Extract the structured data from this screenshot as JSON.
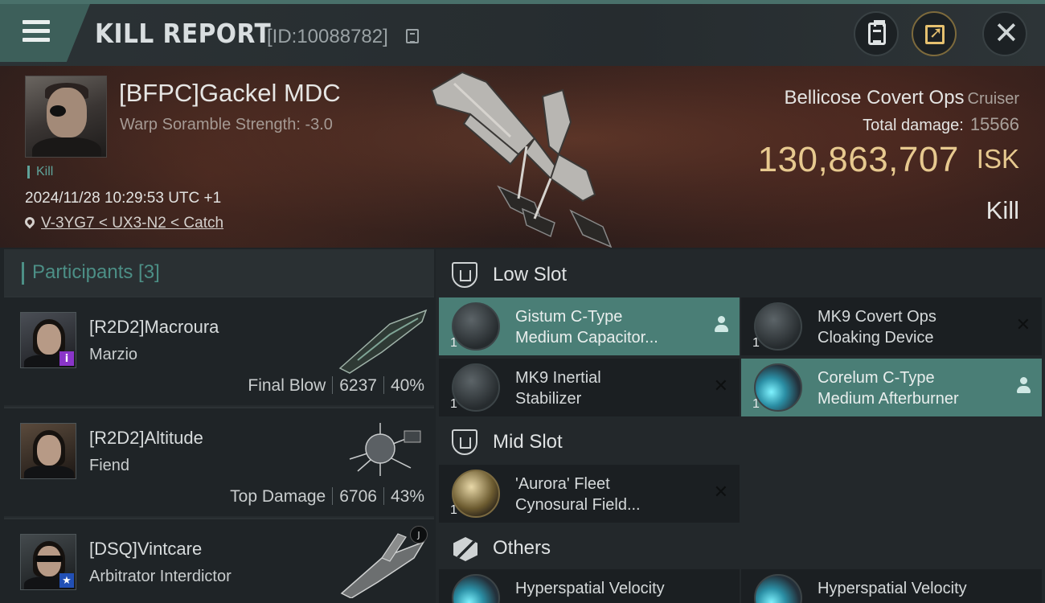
{
  "header": {
    "title": "KILL REPORT",
    "report_id": "[ID:10088782]"
  },
  "victim": {
    "name": "[BFPC]Gackel MDC",
    "scramble": "Warp Soramble Strength: -3.0",
    "tag": "Kill",
    "timestamp": "2024/11/28 10:29:53 UTC +1",
    "location": "V-3YG7 < UX3-N2 < Catch",
    "ship_name": "Bellicose Covert Ops",
    "ship_class": "Cruiser",
    "total_damage_label": "Total damage:",
    "total_damage": "15566",
    "isk_amount": "130,863,707",
    "isk_unit": "ISK",
    "result": "Kill"
  },
  "participants": {
    "title": "Participants [3]",
    "items": [
      {
        "name": "[R2D2]Macroura",
        "ship": "Marzio",
        "role": "Final Blow",
        "damage": "6237",
        "percent": "40%",
        "badge": "i"
      },
      {
        "name": "[R2D2]Altitude",
        "ship": "Fiend",
        "role": "Top Damage",
        "damage": "6706",
        "percent": "43%"
      },
      {
        "name": "[DSQ]Vintcare",
        "ship": "Arbitrator Interdictor",
        "badge": "★",
        "ship_badge": "J"
      }
    ]
  },
  "fitting": {
    "low_slot": {
      "title": "Low Slot",
      "items": [
        {
          "line1": "Gistum C-Type",
          "line2": "Medium Capacitor...",
          "qty": "1"
        },
        {
          "line1": "MK9 Covert Ops",
          "line2": "Cloaking Device",
          "qty": "1"
        },
        {
          "line1": "MK9 Inertial",
          "line2": "Stabilizer",
          "qty": "1"
        },
        {
          "line1": "Corelum C-Type",
          "line2": "Medium Afterburner",
          "qty": "1"
        }
      ]
    },
    "mid_slot": {
      "title": "Mid Slot",
      "items": [
        {
          "line1": "'Aurora' Fleet",
          "line2": "Cynosural Field...",
          "qty": "1"
        }
      ]
    },
    "others": {
      "title": "Others",
      "items": [
        {
          "line1": "Hyperspatial Velocity"
        },
        {
          "line1": "Hyperspatial Velocity"
        }
      ]
    }
  },
  "colors": {
    "accent_teal": "#4a7e76",
    "isk_gold": "#e7c98f",
    "kill_tag": "#5fa39a"
  }
}
